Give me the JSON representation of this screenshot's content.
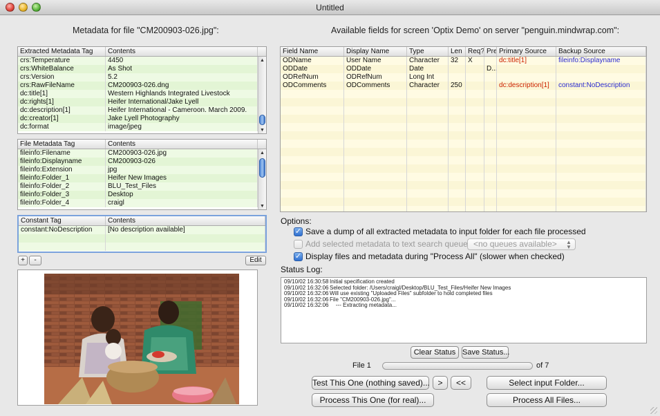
{
  "window": {
    "title": "Untitled"
  },
  "left_heading": "Metadata for file \"CM200903-026.jpg\":",
  "right_heading": "Available fields for screen 'Optix Demo' on server \"penguin.mindwrap.com\":",
  "extracted_table": {
    "headers": [
      "Extracted Metadata Tag",
      "Contents"
    ],
    "rows": [
      [
        "crs:Temperature",
        "4450"
      ],
      [
        "crs:WhiteBalance",
        "As Shot"
      ],
      [
        "crs:Version",
        "5.2"
      ],
      [
        "crs:RawFileName",
        "CM200903-026.dng"
      ],
      [
        "dc:title[1]",
        "Western Highlands Integrated Livestock"
      ],
      [
        "dc:rights[1]",
        "Heifer International/Jake Lyell"
      ],
      [
        "dc:description[1]",
        "Heifer International - Cameroon.  March 2009."
      ],
      [
        "dc:creator[1]",
        "Jake Lyell Photography"
      ],
      [
        "dc:format",
        "image/jpeg"
      ]
    ]
  },
  "file_table": {
    "headers": [
      "File Metadata Tag",
      "Contents"
    ],
    "rows": [
      [
        "fileinfo:Filename",
        "CM200903-026.jpg"
      ],
      [
        "fileinfo:Displayname",
        "CM200903-026"
      ],
      [
        "fileinfo:Extension",
        "jpg"
      ],
      [
        "fileinfo:Folder_1",
        "Heifer New Images"
      ],
      [
        "fileinfo:Folder_2",
        "BLU_Test_Files"
      ],
      [
        "fileinfo:Folder_3",
        "Desktop"
      ],
      [
        "fileinfo:Folder_4",
        "craigl"
      ]
    ]
  },
  "constant_table": {
    "headers": [
      "Constant Tag",
      "Contents"
    ],
    "rows": [
      [
        "constant:NoDescription",
        "[No description available]"
      ]
    ]
  },
  "constant_buttons": {
    "add": "+",
    "remove": "-",
    "edit": "Edit"
  },
  "fields_table": {
    "headers": [
      "Field Name",
      "Display Name",
      "Type",
      "Len",
      "Req?",
      "Pre",
      "Primary Source",
      "Backup Source"
    ],
    "rows": [
      [
        "ODName",
        "User Name",
        "Character",
        "32",
        "X",
        "",
        "dc:title[1]",
        "fileinfo:Displayname"
      ],
      [
        "ODDate",
        "ODDate",
        "Date",
        "",
        "",
        "D...",
        "",
        ""
      ],
      [
        "ODRefNum",
        "ODRefNum",
        "Long Int",
        "",
        "",
        "",
        "",
        ""
      ],
      [
        "ODComments",
        "ODComments",
        "Character",
        "250",
        "",
        "",
        "dc:description[1]",
        "constant:NoDescription"
      ]
    ],
    "empty_rows": 15
  },
  "options": {
    "label": "Options:",
    "save_dump": {
      "label": "Save a dump of all extracted metadata to input folder for each file processed",
      "checked": true
    },
    "add_search": {
      "label": "Add selected metadata to text search queue:",
      "checked": false,
      "enabled": false
    },
    "queue_select": "<no queues available>",
    "display_files": {
      "label": "Display files and metadata during \"Process All\" (slower when checked)",
      "checked": true
    }
  },
  "status_log": {
    "label": "Status Log:",
    "lines": [
      [
        "09/10/02 16:30:58",
        "Initial specification created"
      ],
      [
        "09/10/02 16:32:06",
        "Selected folder: /Users/craigl/Desktop/BLU_Test_Files/Heifer New Images"
      ],
      [
        "09/10/02 16:32:06",
        "Will use existing \"Uploaded Files\" subfolder to hold completed files"
      ],
      [
        "09/10/02 16:32:06",
        "File \"CM200903-026.jpg\"..."
      ],
      [
        "09/10/02 16:32:06",
        "    --- Extracting metadata..."
      ]
    ]
  },
  "buttons": {
    "clear_status": "Clear Status",
    "save_status": "Save Status...",
    "test_one": "Test This One (nothing saved)...",
    "next": ">",
    "first": "<<",
    "select_folder": "Select input Folder...",
    "process_one": "Process This One (for real)...",
    "process_all": "Process All Files..."
  },
  "progress": {
    "file_label": "File 1",
    "of_label": "of 7",
    "value": 0
  },
  "colors": {
    "source_red": "#cc2200",
    "source_blue": "#2a2ad0",
    "accent": "#3b78d8"
  }
}
